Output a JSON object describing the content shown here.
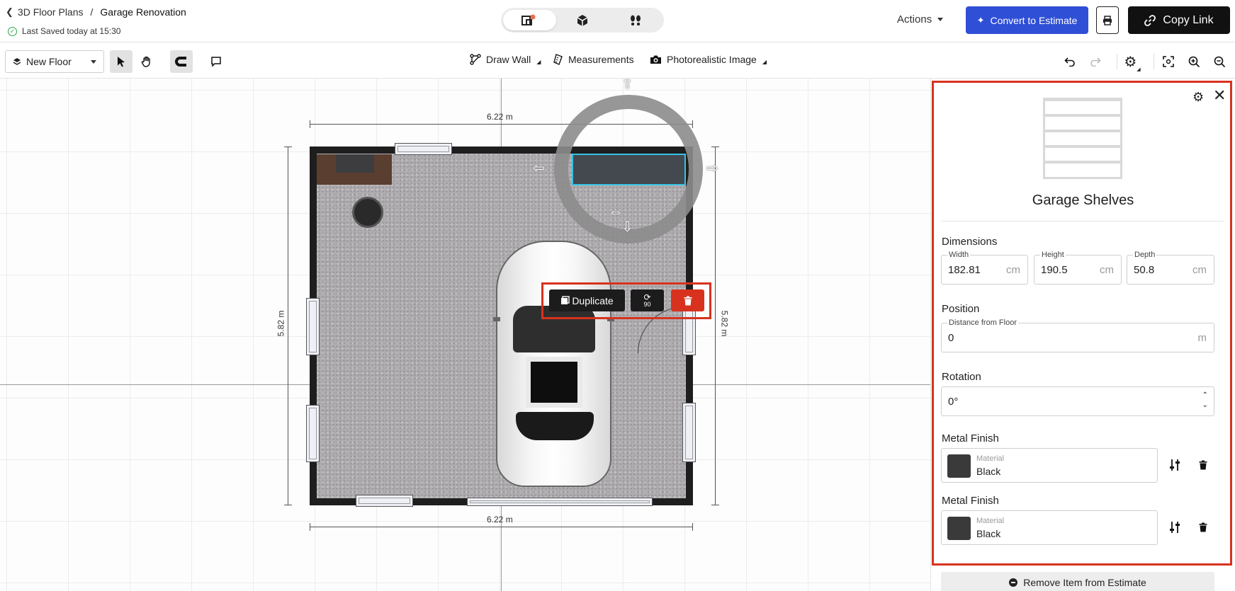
{
  "header": {
    "breadcrumb_parent": "3D Floor Plans",
    "breadcrumb_separator": "/",
    "breadcrumb_current": "Garage Renovation",
    "saved_status": "Last Saved today at 15:30",
    "view_modes": [
      "2d-plan-icon",
      "3d-box-icon",
      "walkthrough-icon"
    ],
    "actions_label": "Actions",
    "convert_label": "Convert to Estimate",
    "copy_link_label": "Copy Link"
  },
  "toolbar": {
    "floor_label": "New Floor",
    "draw_wall_label": "Draw Wall",
    "measurements_label": "Measurements",
    "photo_label": "Photorealistic Image"
  },
  "canvas": {
    "dim_top": "6.22 m",
    "dim_bottom": "6.22 m",
    "dim_left": "5.82 m",
    "dim_right": "5.82 m",
    "context_menu": {
      "duplicate_label": "Duplicate",
      "rotate_label": "90"
    }
  },
  "panel": {
    "item_title": "Garage Shelves",
    "dimensions_title": "Dimensions",
    "width_label": "Width",
    "width_value": "182.81",
    "height_label": "Height",
    "height_value": "190.5",
    "depth_label": "Depth",
    "depth_value": "50.8",
    "unit_cm": "cm",
    "position_title": "Position",
    "distance_label": "Distance from Floor",
    "distance_value": "0",
    "unit_m": "m",
    "rotation_title": "Rotation",
    "rotation_value": "0°",
    "finishes": [
      {
        "title": "Metal Finish",
        "material_label": "Material",
        "material_value": "Black"
      },
      {
        "title": "Metal Finish",
        "material_label": "Material",
        "material_value": "Black"
      }
    ],
    "remove_label": "Remove Item from Estimate"
  },
  "colors": {
    "accent_blue": "#2f4fd6",
    "highlight_red": "#d8321e",
    "selection_cyan": "#35c3e6",
    "saved_green": "#2ea24a"
  }
}
